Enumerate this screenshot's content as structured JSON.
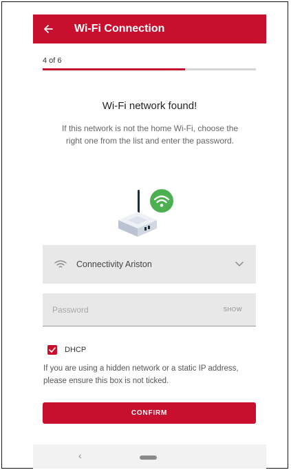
{
  "appbar": {
    "title": "Wi-Fi Connection",
    "back_icon": "arrow-left-icon"
  },
  "progress": {
    "step_text": "4 of 6",
    "fraction": 0.66667
  },
  "content": {
    "headline": "Wi-Fi network found!",
    "description": "If this network is not the home Wi-Fi, choose the right one from the list and enter the password."
  },
  "illustration": {
    "icon": "router-wifi-icon",
    "badge_color": "#4caf50"
  },
  "network_select": {
    "value": "Connectivity Ariston",
    "icon": "wifi-icon",
    "dropdown_icon": "chevron-down-icon"
  },
  "password": {
    "placeholder": "Password",
    "show_label": "SHOW"
  },
  "dhcp": {
    "label": "DHCP",
    "checked": true
  },
  "hint": "If you are using a hidden network or a static IP address, please ensure this box is not ticked.",
  "confirm_label": "CONFIRM",
  "nav": {
    "back_glyph": "‹"
  },
  "colors": {
    "brand": "#c8102e",
    "field_bg": "#e8e8e8",
    "success": "#4caf50"
  }
}
